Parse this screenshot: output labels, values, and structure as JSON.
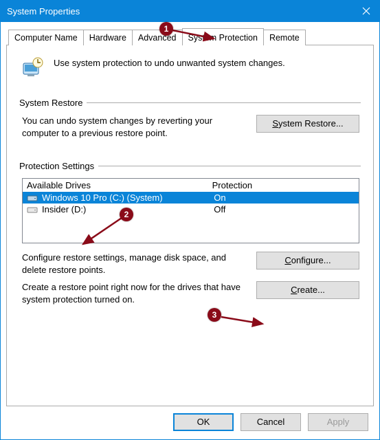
{
  "window": {
    "title": "System Properties"
  },
  "tabs": {
    "items": [
      {
        "label": "Computer Name"
      },
      {
        "label": "Hardware"
      },
      {
        "label": "Advanced"
      },
      {
        "label": "System Protection"
      },
      {
        "label": "Remote"
      }
    ],
    "active_index": 3
  },
  "intro": {
    "text": "Use system protection to undo unwanted system changes."
  },
  "system_restore": {
    "legend": "System Restore",
    "desc": "You can undo system changes by reverting your computer to a previous restore point.",
    "button": "System Restore..."
  },
  "protection_settings": {
    "legend": "Protection Settings",
    "columns": {
      "drive": "Available Drives",
      "protection": "Protection"
    },
    "drives": [
      {
        "name": "Windows 10 Pro (C:) (System)",
        "protection": "On",
        "selected": true
      },
      {
        "name": "Insider (D:)",
        "protection": "Off",
        "selected": false
      }
    ],
    "configure_desc": "Configure restore settings, manage disk space, and delete restore points.",
    "configure_button": "Configure...",
    "create_desc": "Create a restore point right now for the drives that have system protection turned on.",
    "create_button": "Create..."
  },
  "footer": {
    "ok": "OK",
    "cancel": "Cancel",
    "apply": "Apply"
  },
  "annotations": {
    "m1": "1",
    "m2": "2",
    "m3": "3"
  }
}
